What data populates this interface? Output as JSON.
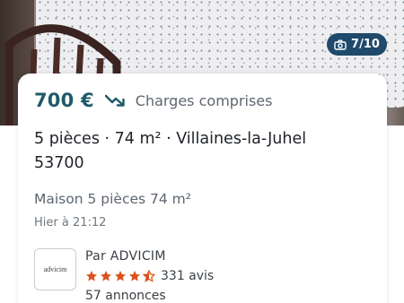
{
  "photo": {
    "counter": "7/10",
    "camera_icon": "camera-icon"
  },
  "listing": {
    "price": "700 €",
    "price_trend_icon": "trend-down-icon",
    "charges": "Charges comprises",
    "title": "5 pièces · 74 m² · Villaines-la-Juhel 53700",
    "subtitle": "Maison 5 pièces 74 m²",
    "date": "Hier à 21:12"
  },
  "agency": {
    "logo_text": "advicim",
    "name": "Par ADVICIM",
    "rating": 4.5,
    "reviews": "331 avis",
    "listings": "57 annonces"
  },
  "colors": {
    "price": "#1f5a68",
    "badge_bg": "#1f4a6b",
    "star": "#d9531e"
  }
}
